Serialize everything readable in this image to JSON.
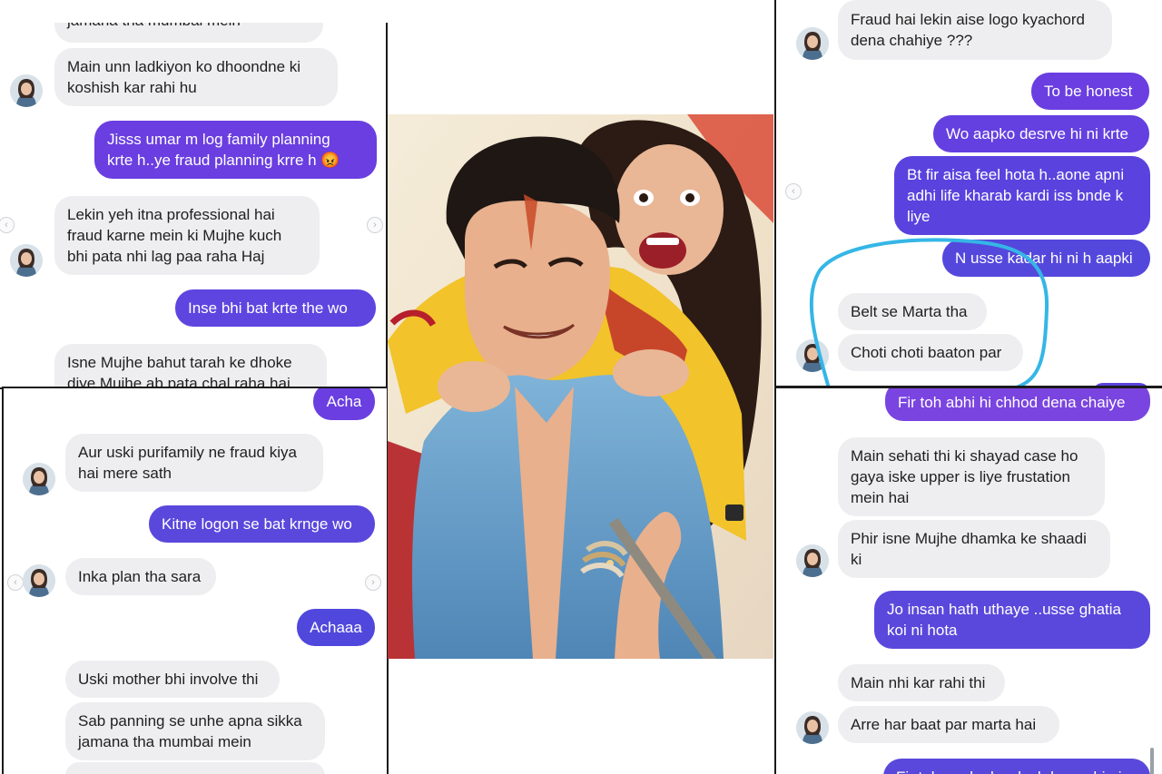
{
  "colors": {
    "outgoing_bubble": "#6a3ee0",
    "incoming_bubble": "#eeeef0",
    "highlight_circle": "#35b6e6"
  },
  "icons": {
    "avatar": "profile-avatar-icon",
    "prev": "chevron-left-icon",
    "next": "chevron-right-icon"
  },
  "panel_top_left": {
    "messages": [
      {
        "from": "them",
        "text": "jamana tha mumbai mein"
      },
      {
        "from": "them",
        "text": "Main unn ladkiyon ko dhoondne ki\nkoshish kar rahi hu"
      },
      {
        "from": "me",
        "text": "Jisss umar m log family planning\nkrte h..ye fraud planning krre h 😡"
      },
      {
        "from": "them",
        "text": "Lekin yeh itna professional hai\nfraud karne mein ki Mujhe kuch\nbhi pata nhi lag paa raha Haj"
      },
      {
        "from": "me",
        "text": "Inse bhi bat krte the wo"
      },
      {
        "from": "them",
        "text": "Isne Mujhe bahut tarah ke dhoke\ndiye Mujhe ab pata chal raha hai"
      }
    ]
  },
  "panel_bottom_left": {
    "messages": [
      {
        "from": "me",
        "text": "Acha"
      },
      {
        "from": "them",
        "text": "Aur uski purifamily ne fraud kiya\nhai mere sath"
      },
      {
        "from": "me",
        "text": "Kitne logon se bat krnge wo"
      },
      {
        "from": "them",
        "text": "Inka plan tha sara"
      },
      {
        "from": "me",
        "text": "Achaaa"
      },
      {
        "from": "them",
        "text": "Uski mother bhi involve thi"
      },
      {
        "from": "them",
        "text": "Sab panning se unhe apna sikka\njamana tha mumbai mein"
      }
    ]
  },
  "panel_top_right": {
    "messages": [
      {
        "from": "them",
        "text": "Fraud hai lekin aise logo kyachord\ndena chahiye ???"
      },
      {
        "from": "me",
        "text": "To be honest"
      },
      {
        "from": "me",
        "text": "Wo aapko desrve hi ni krte"
      },
      {
        "from": "me",
        "text": "Bt fir aisa feel hota h..aone apni\nadhi life kharab kardi iss bnde k\nliye"
      },
      {
        "from": "me",
        "text": "N usse kadar hi ni h aapki"
      },
      {
        "from": "them",
        "text": "Belt se Marta tha"
      },
      {
        "from": "them",
        "text": "Choti choti baaton par"
      }
    ]
  },
  "panel_bottom_right": {
    "messages": [
      {
        "from": "me",
        "text": "Fir toh abhi hi chhod dena chaiye"
      },
      {
        "from": "them",
        "text": "Main sehati thi ki shayad case ho\ngaya iske upper is liye frustation\nmein hai"
      },
      {
        "from": "them",
        "text": "Phir isne Mujhe dhamka ke shaadi\nki"
      },
      {
        "from": "me",
        "text": "Jo insan hath uthaye ..usse ghatia\nkoi ni hota"
      },
      {
        "from": "them",
        "text": "Main nhi kar rahi thi"
      },
      {
        "from": "them",
        "text": "Arre har baat par marta hai"
      },
      {
        "from": "me",
        "text": "Fir toh aapko bardash karna hi ni"
      }
    ]
  }
}
